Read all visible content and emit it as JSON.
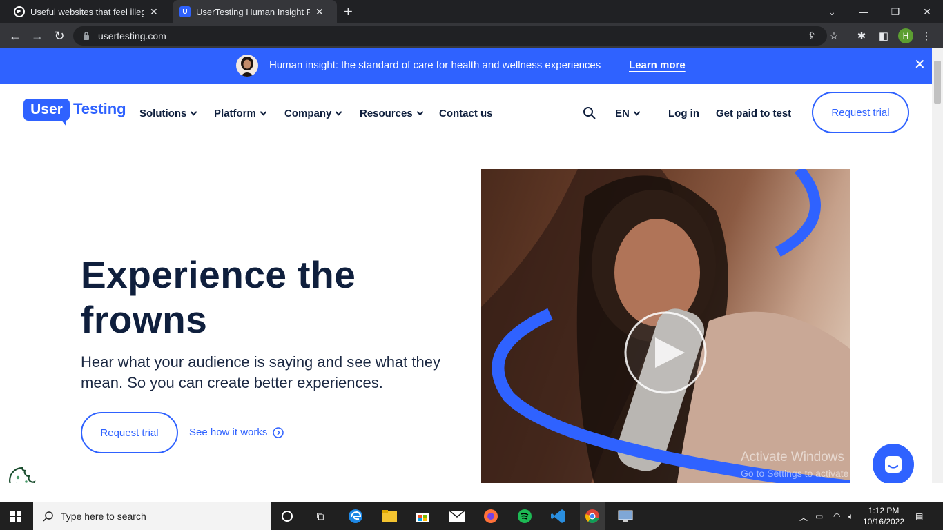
{
  "browser": {
    "tabs": [
      {
        "title": "Useful websites that feel illegal to",
        "active": false
      },
      {
        "title": "UserTesting Human Insight Platfo",
        "active": true
      }
    ],
    "new_tab_label": "+",
    "url": "usertesting.com",
    "profile_initial": "H"
  },
  "banner": {
    "text": "Human insight: the standard of care for health and wellness experiences",
    "link": "Learn more",
    "color": "#2f62ff"
  },
  "nav": {
    "logo_box": "User",
    "logo_text": "Testing",
    "items": [
      "Solutions",
      "Platform",
      "Company",
      "Resources",
      "Contact us"
    ],
    "language": "EN",
    "login": "Log in",
    "get_paid": "Get paid to test",
    "request_trial": "Request trial"
  },
  "hero": {
    "title": "Experience the frowns",
    "subtitle": "Hear what your audience is saying and see what they mean. So you can create better experiences.",
    "cta_primary": "Request trial",
    "cta_secondary": "See how it works"
  },
  "watermark": {
    "line1": "Activate Windows",
    "line2": "Go to Settings to activate Windows."
  },
  "taskbar": {
    "search_placeholder": "Type here to search",
    "time": "1:12 PM",
    "date": "10/16/2022"
  }
}
